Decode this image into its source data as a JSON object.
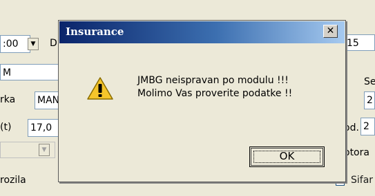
{
  "background": {
    "time_value": ":00",
    "letter_d": "D",
    "right_number": "15",
    "letter_m": "M",
    "label_marka": "rka",
    "value_marka": "MAN",
    "label_t": "(t)",
    "value_t": "17,0",
    "right_se": "Se",
    "right_2a": "2",
    "right_2b": "2",
    "label_od": "od.",
    "label_otora": "otora",
    "label_vozila": "rozila",
    "label_sifar": "Sifar"
  },
  "dialog": {
    "title": "Insurance",
    "close_label": "✕",
    "message_line1": "JMBG neispravan po modulu !!!",
    "message_line2": "Molimo Vas proverite podatke !!",
    "ok_label": "OK"
  },
  "colors": {
    "title_gradient_start": "#0a246a",
    "title_gradient_end": "#a6caf0",
    "warning_yellow": "#f5c52b"
  }
}
